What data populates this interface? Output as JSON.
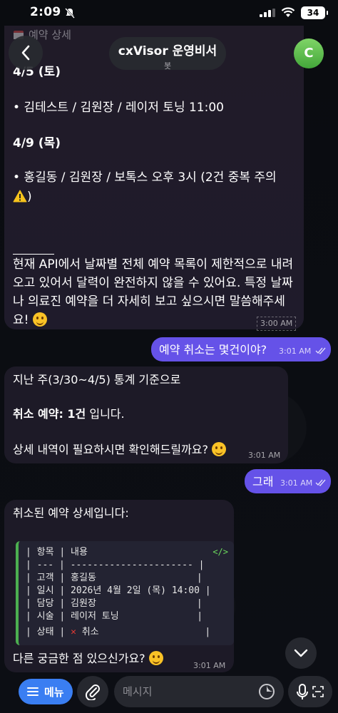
{
  "status_bar": {
    "time": "2:09",
    "battery": "34"
  },
  "pinned": {
    "label": "예약 상세"
  },
  "header": {
    "title": "cxVisor 운영비서",
    "subtitle": "봇",
    "avatar_letter": "C"
  },
  "messages": [
    {
      "sender": "bot",
      "lines": {
        "date1": "4/5 (토)",
        "item1": "• 김테스트 / 김원장 / 레이저 토닝 11:00",
        "date2": "4/9 (목)",
        "item2a": "• 홍길동 / 김원장 / 보톡스 오후 3시 (2건 중복 주의",
        "item2b": ")",
        "p1": "현재 API에서 날짜별 전체 예약 목록이 제한적으로 내려",
        "p2": "오고 있어서 달력이 완전하지 않을 수 있어요. 특정 날짜",
        "p3": "나 의료진 예약을 더 자세히 보고 싶으시면 말씀해주세",
        "p4": "요!"
      },
      "time": "3:00 AM"
    },
    {
      "sender": "user",
      "text": "예약 취소는 몇건이야?",
      "time": "3:01 AM"
    },
    {
      "sender": "bot",
      "lines": {
        "l1": "지난 주(3/30~4/5) 통계 기준으로",
        "l2_bold": "취소 예약: 1건",
        "l2_rest": " 입니다.",
        "l3": "상세 내역이 필요하시면 확인해드릴까요?"
      },
      "time": "3:01 AM"
    },
    {
      "sender": "user",
      "text": "그래",
      "time": "3:01 AM"
    },
    {
      "sender": "bot",
      "lines": {
        "intro": "취소된 예약 상세입니다:",
        "outro": "다른 궁금한 점 있으신가요?"
      },
      "code_rows": [
        "| 항목 | 내용",
        "| --- | ---------------------- |",
        "| 고객 | 홍길동                  |",
        "| 일시 | 2026년 4월 2일 (목) 14:00 |",
        "| 담당 | 김원장                  |",
        "| 시술 | 레이저 토닝              |",
        "| 상태 | ",
        "      취소                   |"
      ],
      "code_row_status_prefix": "| 상태 | ",
      "code_row_status_text": " 취소",
      "code_row_status_suffix": "                   |",
      "code_icon": "</>",
      "time": "3:01 AM"
    }
  ],
  "input": {
    "menu_label": "메뉴",
    "placeholder": "메시지"
  },
  "icons": [
    "bell-slash-icon",
    "signal-icon",
    "wifi-icon",
    "back-arrow-icon",
    "warning-icon",
    "smile-emoji-icon",
    "code-icon",
    "cross-mark-icon",
    "chevron-down-icon",
    "menu-icon",
    "paperclip-icon",
    "sticker-icon",
    "microphone-icon",
    "double-check-icon"
  ],
  "colors": {
    "user_bubble": "#6552e8",
    "bot_bubble": "#1d1a27",
    "menu_button": "#3a7ef2",
    "avatar": "#5bbf48",
    "code_border": "#4caf50"
  }
}
